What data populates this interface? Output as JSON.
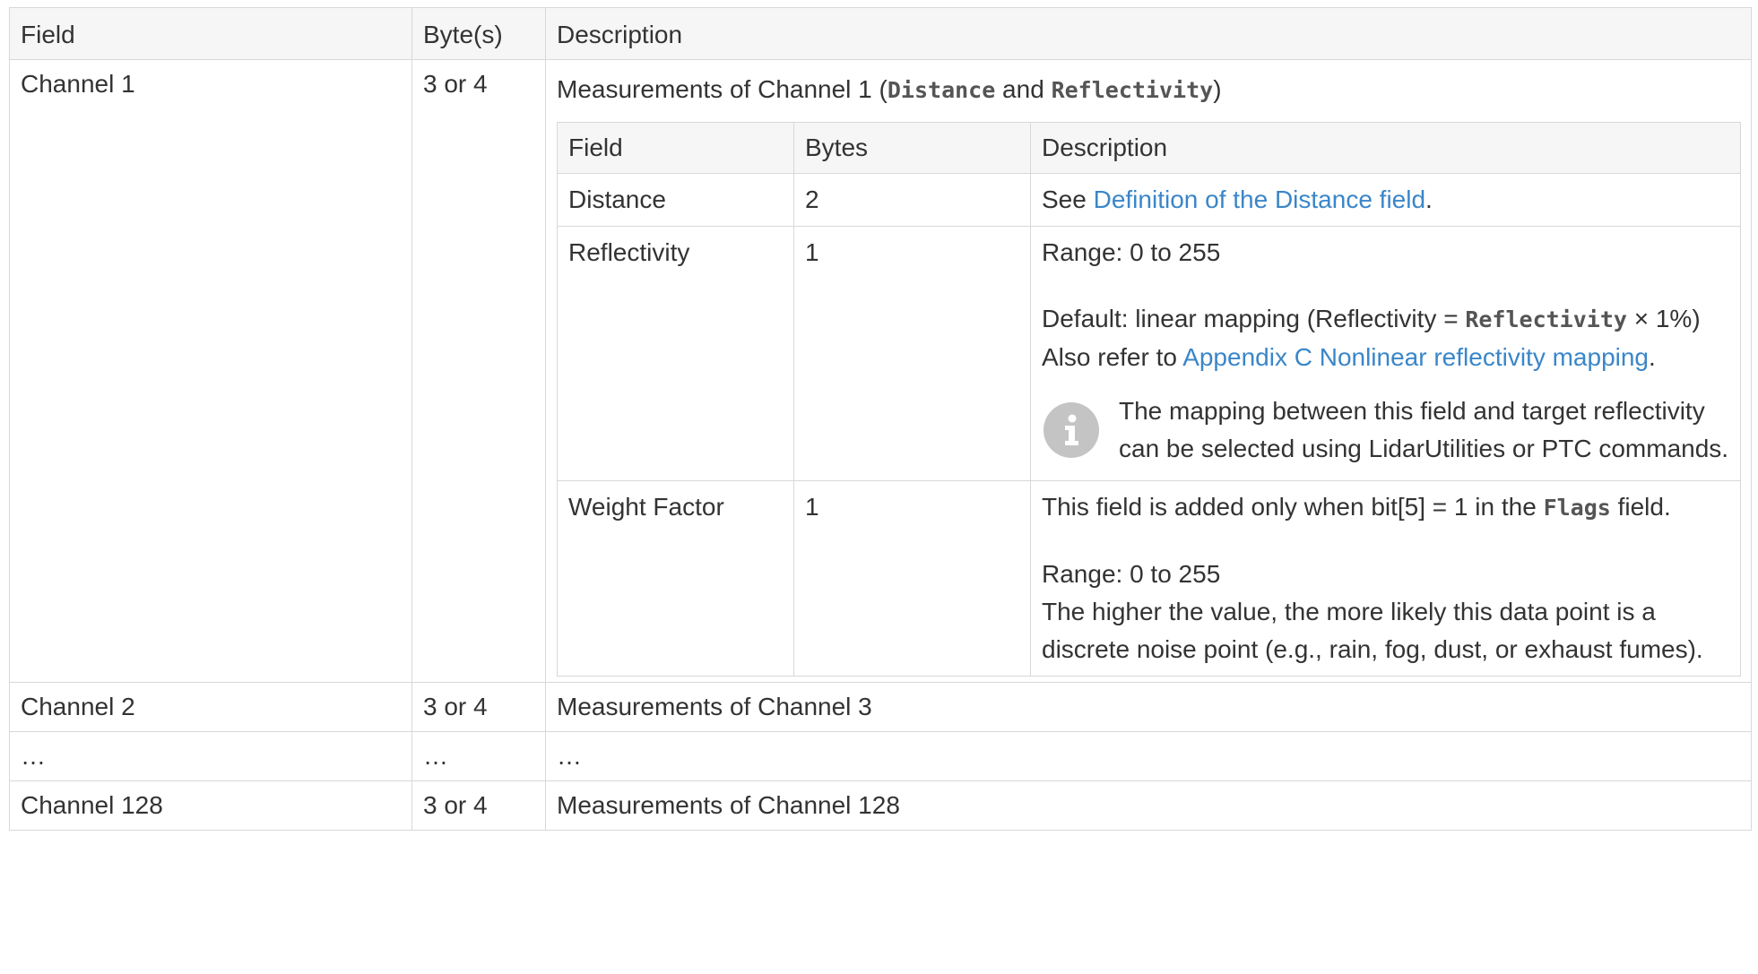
{
  "headers": {
    "field": "Field",
    "bytes": "Byte(s)",
    "description": "Description"
  },
  "rows": [
    {
      "field": "Channel 1",
      "bytes": "3 or 4",
      "desc_prefix": "Measurements of Channel 1 (",
      "desc_code1": "Distance",
      "desc_and": " and ",
      "desc_code2": "Reflectivity",
      "desc_suffix": ")"
    },
    {
      "field": "Channel 2",
      "bytes": "3 or 4",
      "description": "Measurements of Channel 3"
    },
    {
      "field": "…",
      "bytes": "…",
      "description": "…"
    },
    {
      "field": "Channel 128",
      "bytes": "3 or 4",
      "description": "Measurements of Channel 128"
    }
  ],
  "inner": {
    "headers": {
      "field": "Field",
      "bytes": "Bytes",
      "description": "Description"
    },
    "distance": {
      "field": "Distance",
      "bytes": "2",
      "see": "See ",
      "link": "Definition of the Distance field",
      "period": "."
    },
    "reflectivity": {
      "field": "Reflectivity",
      "bytes": "1",
      "range": "Range: 0 to 255",
      "default_prefix": "Default: linear mapping (Reflectivity = ",
      "default_code": "Reflectivity",
      "default_suffix": " × 1%)",
      "refer_prefix": "Also refer to ",
      "refer_link": "Appendix C Nonlinear reflectivity mapping",
      "refer_suffix": ".",
      "note": "The mapping between this field and target reflectivity can be selected using LidarUtilities or PTC commands.",
      "note_icon": "info-icon"
    },
    "weight": {
      "field": "Weight Factor",
      "bytes": "1",
      "added_prefix": "This field is added only when bit[5] = 1 in the ",
      "added_code": "Flags",
      "added_suffix": " field.",
      "range": "Range: 0 to 255",
      "explain": "The higher the value, the more likely this data point is a discrete noise point (e.g., rain, fog, dust, or exhaust fumes)."
    }
  },
  "colors": {
    "border": "#d8d8d8",
    "header_bg": "#f6f6f6",
    "link": "#3a86c8",
    "icon_bg": "#c4c4c4"
  }
}
